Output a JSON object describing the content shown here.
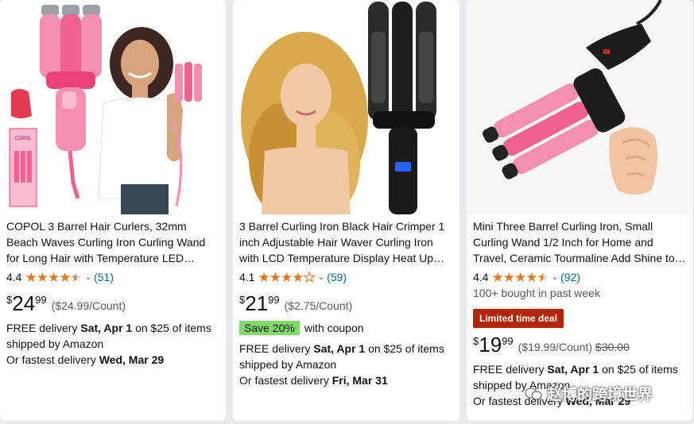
{
  "products": [
    {
      "title": "COPOL 3 Barrel Hair Curlers, 32mm Beach Waves Curling Iron Curling Wand for Long Hair with Temperature LED Indicator / Ceramic Tourmaline",
      "rating": "4.4",
      "reviews": "(51)",
      "price_symbol": "$",
      "price_whole": "24",
      "price_fraction": "99",
      "unit_price": "($24.99/Count)",
      "delivery_prefix": "FREE delivery ",
      "delivery_date": "Sat, Apr 1",
      "delivery_suffix": " on $25 of items",
      "shipped_by": "shipped by Amazon",
      "fastest_prefix": "Or fastest delivery ",
      "fastest_date": "Wed, Mar 29"
    },
    {
      "title": "3 Barrel Curling Iron Black Hair Crimper 1 inch Adjustable Hair Waver Curling Iron with LCD Temperature Display Heat Up Quickly",
      "rating": "4.1",
      "reviews": "(59)",
      "price_symbol": "$",
      "price_whole": "21",
      "price_fraction": "99",
      "unit_price": "($2.75/Count)",
      "coupon_badge": "Save 20%",
      "coupon_text": "with coupon",
      "delivery_prefix": "FREE delivery ",
      "delivery_date": "Sat, Apr 1",
      "delivery_suffix": " on $25 of items",
      "shipped_by": "shipped by Amazon",
      "fastest_prefix": "Or fastest delivery ",
      "fastest_date": "Fri, Mar 31"
    },
    {
      "title": "Mini Three Barrel Curling Iron, Small Curling Wand 1/2 Inch for Home and Travel, Ceramic Tourmaline Add Shine to Hair",
      "rating": "4.4",
      "reviews": "(92)",
      "bought": "100+ bought in past week",
      "deal_badge": "Limited time deal",
      "price_symbol": "$",
      "price_whole": "19",
      "price_fraction": "99",
      "unit_price": "($19.99/Count)",
      "list_price": "$30.00",
      "delivery_prefix": "FREE delivery ",
      "delivery_date": "Sat, Apr 1",
      "delivery_suffix": " on $25 of items",
      "shipped_by": "shipped by Amazon",
      "fastest_prefix": "Or fastest delivery ",
      "fastest_date": "Wed, Mar 29"
    }
  ],
  "image_text": {
    "box_brand": "COPOL"
  },
  "watermark": "赵博的跨境世界",
  "colors": {
    "star": "#de7921",
    "link": "#007185",
    "deal": "#b12704",
    "coupon": "#7fda69"
  }
}
